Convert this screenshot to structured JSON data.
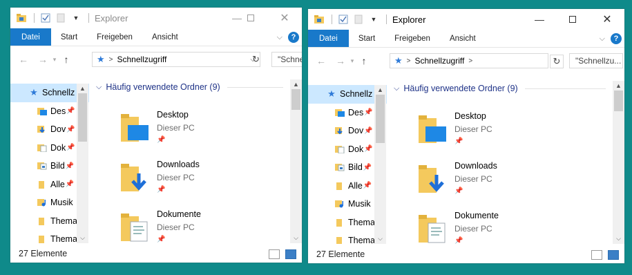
{
  "windows": [
    {
      "title": "Explorer",
      "ribbon_tabs": [
        "Datei",
        "Start",
        "Freigeben",
        "Ansicht"
      ],
      "address_path": "Schnellzugriff",
      "search_placeholder": "\"Schnellzu",
      "nav_items": [
        {
          "label": "Schnellz",
          "icon": "star-icon",
          "selected": true,
          "pinned": false
        },
        {
          "label": "Des",
          "icon": "desktop-folder-icon",
          "pinned": true
        },
        {
          "label": "Dov",
          "icon": "downloads-folder-icon",
          "pinned": true
        },
        {
          "label": "Dok",
          "icon": "documents-folder-icon",
          "pinned": true
        },
        {
          "label": "Bild",
          "icon": "pictures-folder-icon",
          "pinned": true
        },
        {
          "label": "Alle",
          "icon": "folder-icon",
          "pinned": true
        },
        {
          "label": "Musik",
          "icon": "music-folder-icon",
          "pinned": false
        },
        {
          "label": "Thema",
          "icon": "folder-icon",
          "pinned": false
        },
        {
          "label": "Thema",
          "icon": "folder-icon",
          "pinned": false
        }
      ],
      "group_header": "Häufig verwendete Ordner (9)",
      "tiles": [
        {
          "name": "Desktop",
          "location": "Dieser PC",
          "icon": "desktop-folder-icon"
        },
        {
          "name": "Downloads",
          "location": "Dieser PC",
          "icon": "downloads-folder-icon"
        },
        {
          "name": "Dokumente",
          "location": "Dieser PC",
          "icon": "documents-folder-icon"
        }
      ],
      "status": "27 Elemente"
    },
    {
      "title": "Explorer",
      "ribbon_tabs": [
        "Datei",
        "Start",
        "Freigeben",
        "Ansicht"
      ],
      "address_path": "Schnellzugriff",
      "search_placeholder": "\"Schnellzu...",
      "nav_items": [
        {
          "label": "Schnellz",
          "icon": "star-icon",
          "selected": true,
          "pinned": false
        },
        {
          "label": "Des",
          "icon": "desktop-folder-icon",
          "pinned": true
        },
        {
          "label": "Dov",
          "icon": "downloads-folder-icon",
          "pinned": true
        },
        {
          "label": "Dok",
          "icon": "documents-folder-icon",
          "pinned": true
        },
        {
          "label": "Bild",
          "icon": "pictures-folder-icon",
          "pinned": true
        },
        {
          "label": "Alle",
          "icon": "folder-icon",
          "pinned": true
        },
        {
          "label": "Musik",
          "icon": "music-folder-icon",
          "pinned": false
        },
        {
          "label": "Thema",
          "icon": "folder-icon",
          "pinned": false
        },
        {
          "label": "Thema",
          "icon": "folder-icon",
          "pinned": false
        }
      ],
      "group_header": "Häufig verwendete Ordner (9)",
      "tiles": [
        {
          "name": "Desktop",
          "location": "Dieser PC",
          "icon": "desktop-folder-icon"
        },
        {
          "name": "Downloads",
          "location": "Dieser PC",
          "icon": "downloads-folder-icon"
        },
        {
          "name": "Dokumente",
          "location": "Dieser PC",
          "icon": "documents-folder-icon"
        }
      ],
      "status": "27 Elemente"
    }
  ],
  "colors": {
    "desktop_bg": "#0f8a8a",
    "file_tab": "#1979ca",
    "selected": "#cce8ff",
    "group_header": "#1e3287",
    "folder": "#f4c95d"
  }
}
